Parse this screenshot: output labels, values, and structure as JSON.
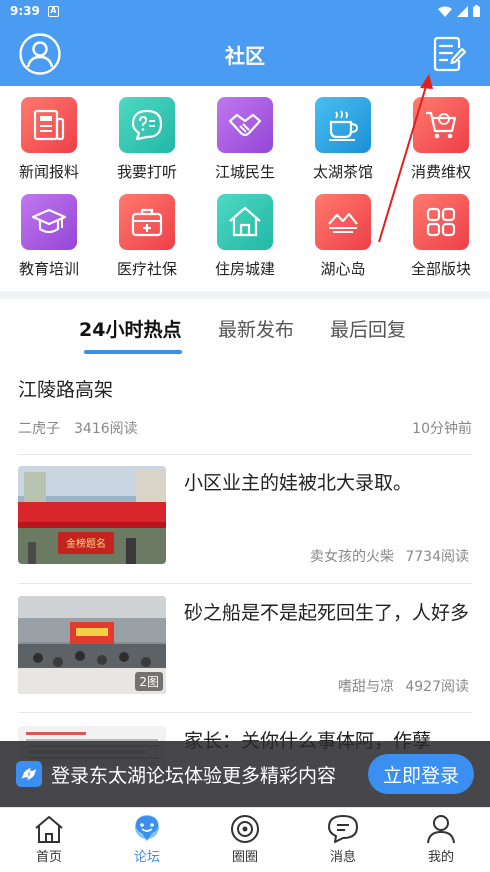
{
  "status_bar": {
    "time": "9:39",
    "a_badge": "A"
  },
  "header": {
    "title": "社区"
  },
  "categories": [
    {
      "label": "新闻报料",
      "icon": "newspaper-icon",
      "color": "#f2574f"
    },
    {
      "label": "我要打听",
      "icon": "chat-question-icon",
      "color": "#35c6b1"
    },
    {
      "label": "江城民生",
      "icon": "handshake-icon",
      "color": "#a95be0"
    },
    {
      "label": "太湖茶馆",
      "icon": "teacup-icon",
      "color": "#2ea6e6"
    },
    {
      "label": "消费维权",
      "icon": "shopping-cart-icon",
      "color": "#f2574f"
    },
    {
      "label": "教育培训",
      "icon": "graduation-cap-icon",
      "color": "#a95be0"
    },
    {
      "label": "医疗社保",
      "icon": "medical-kit-icon",
      "color": "#f2574f"
    },
    {
      "label": "住房城建",
      "icon": "house-icon",
      "color": "#35c6b1"
    },
    {
      "label": "湖心岛",
      "icon": "mountain-lake-icon",
      "color": "#f2574f"
    },
    {
      "label": "全部版块",
      "icon": "grid-icon",
      "color": "#f2574f"
    }
  ],
  "tabs": [
    "24小时热点",
    "最新发布",
    "最后回复"
  ],
  "posts": [
    {
      "title": "江陵路高架",
      "author": "二虎子",
      "reads": "3416阅读",
      "time": "10分钟前"
    },
    {
      "title": "小区业主的娃被北大录取。",
      "author": "卖女孩的火柴",
      "reads": "7734阅读"
    },
    {
      "title": "砂之船是不是起死回生了，人好多",
      "author": "嗜甜与凉",
      "reads": "4927阅读",
      "image_count": "2图"
    },
    {
      "title": "家长：关你什么事体阿，作孽"
    }
  ],
  "login_banner": {
    "message": "登录东太湖论坛体验更多精彩内容",
    "button": "立即登录"
  },
  "bottom_nav": [
    {
      "label": "首页",
      "icon": "home-icon"
    },
    {
      "label": "论坛",
      "icon": "forum-icon"
    },
    {
      "label": "圈圈",
      "icon": "circle-icon"
    },
    {
      "label": "消息",
      "icon": "message-icon"
    },
    {
      "label": "我的",
      "icon": "user-icon"
    }
  ],
  "colors": {
    "brand": "#4a9cf2",
    "accent": "#3b8ff0",
    "annotation": "#e0201f"
  }
}
